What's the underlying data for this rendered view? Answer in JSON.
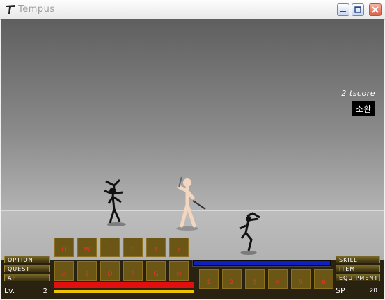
{
  "window": {
    "title": "Tempus"
  },
  "hud_top": {
    "score_text": "2 tscore",
    "summon_label": "소환"
  },
  "menu_left": [
    "OPTION",
    "QUEST",
    "AP"
  ],
  "menu_right": [
    "SKILL",
    "ITEM",
    "EQUIPMENT"
  ],
  "level": {
    "label": "Lv.",
    "value": "2"
  },
  "sp": {
    "label": "SP",
    "value": "20"
  },
  "skill_keys_top": [
    "Q",
    "W",
    "E",
    "R",
    "T",
    "Y"
  ],
  "skill_keys_bottom": [
    "A",
    "8",
    "D",
    "F",
    "G",
    "H"
  ],
  "item_keys": [
    "1",
    "2",
    "3",
    "4",
    "5",
    "6"
  ],
  "colors": {
    "hp": "#e01010",
    "mp": "#1020c0",
    "exp": "#f0c000",
    "slot": "#6b5616"
  },
  "icons": {
    "app": "tempus-logo-icon",
    "minimize": "minimize-icon",
    "maximize": "maximize-icon",
    "close": "close-icon"
  }
}
